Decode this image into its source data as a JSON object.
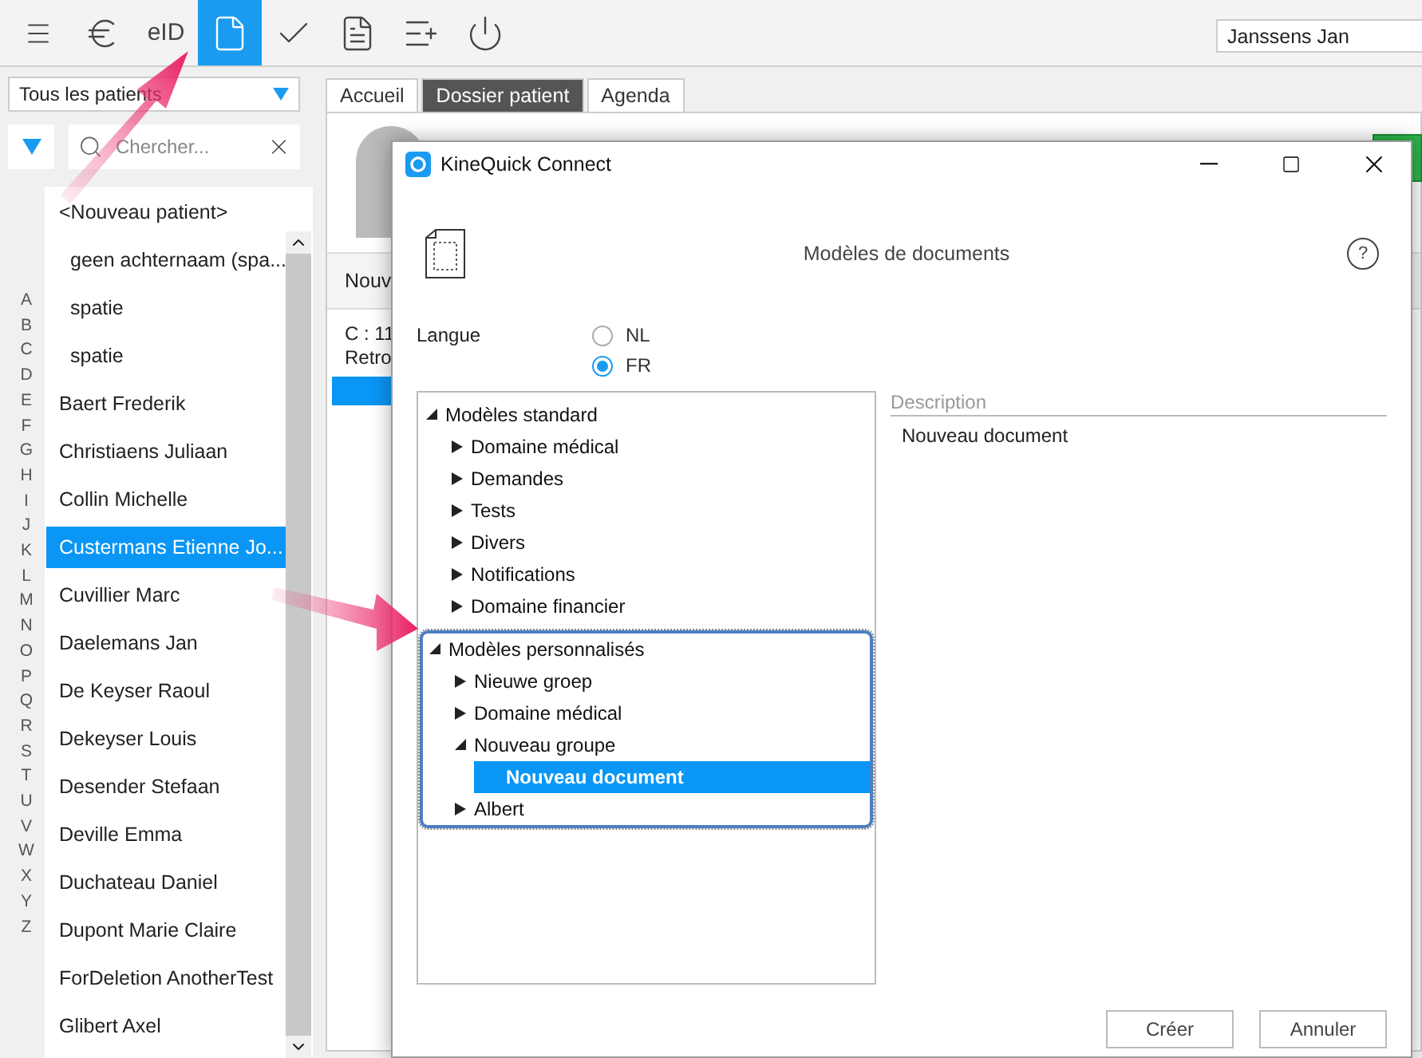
{
  "toolbar": [
    {
      "kind": "menu",
      "selected": false
    },
    {
      "kind": "euro",
      "selected": false
    },
    {
      "kind": "eid",
      "label": "eID",
      "selected": false
    },
    {
      "kind": "document",
      "selected": true
    },
    {
      "kind": "check",
      "selected": false
    },
    {
      "kind": "invoice",
      "selected": false
    },
    {
      "kind": "addlist",
      "selected": false
    },
    {
      "kind": "power",
      "selected": false
    }
  ],
  "user_field": {
    "value": "Janssens Jan"
  },
  "sidebar": {
    "filter": {
      "value": "Tous les patients"
    },
    "search": {
      "placeholder": "Chercher..."
    },
    "letters": [
      "A",
      "B",
      "C",
      "D",
      "E",
      "F",
      "G",
      "H",
      "I",
      "J",
      "K",
      "L",
      "M",
      "N",
      "O",
      "P",
      "Q",
      "R",
      "S",
      "T",
      "U",
      "V",
      "W",
      "X",
      "Y",
      "Z"
    ],
    "patients": [
      {
        "name": "<Nouveau patient>",
        "indented": false,
        "selected": false
      },
      {
        "name": "geen achternaam (spa...",
        "indented": true,
        "selected": false
      },
      {
        "name": "spatie",
        "indented": true,
        "selected": false
      },
      {
        "name": "spatie",
        "indented": true,
        "selected": false
      },
      {
        "name": "Baert Frederik",
        "indented": false,
        "selected": false
      },
      {
        "name": "Christiaens Juliaan",
        "indented": false,
        "selected": false
      },
      {
        "name": "Collin Michelle",
        "indented": false,
        "selected": false
      },
      {
        "name": "Custermans Etienne Jo...",
        "indented": false,
        "selected": true
      },
      {
        "name": "Cuvillier Marc",
        "indented": false,
        "selected": false
      },
      {
        "name": "Daelemans Jan",
        "indented": false,
        "selected": false
      },
      {
        "name": "De Keyser Raoul",
        "indented": false,
        "selected": false
      },
      {
        "name": "Dekeyser Louis",
        "indented": false,
        "selected": false
      },
      {
        "name": "Desender Stefaan",
        "indented": false,
        "selected": false
      },
      {
        "name": "Deville Emma",
        "indented": false,
        "selected": false
      },
      {
        "name": "Duchateau Daniel",
        "indented": false,
        "selected": false
      },
      {
        "name": "Dupont Marie Claire",
        "indented": false,
        "selected": false
      },
      {
        "name": "ForDeletion AnotherTest",
        "indented": false,
        "selected": false
      },
      {
        "name": "Glibert Axel",
        "indented": false,
        "selected": false
      }
    ]
  },
  "main_tabs": [
    {
      "label": "Accueil",
      "selected": false
    },
    {
      "label": "Dossier patient",
      "selected": true
    },
    {
      "label": "Agenda",
      "selected": false
    }
  ],
  "patient_panel": {
    "row_1": "Nouv",
    "line_1": "C : 11",
    "line_2": "Retro"
  },
  "dialog": {
    "title": "KineQuick Connect",
    "heading": "Modèles de documents",
    "language": {
      "label": "Langue",
      "options": [
        {
          "label": "NL",
          "selected": false
        },
        {
          "label": "FR",
          "selected": true
        }
      ]
    },
    "tree": [
      {
        "label": "Modèles standard",
        "expanded": true,
        "focused": false,
        "selected": false,
        "children": [
          {
            "label": "Domaine médical",
            "expanded": false,
            "focused": false,
            "selected": false
          },
          {
            "label": "Demandes",
            "expanded": false,
            "focused": false,
            "selected": false
          },
          {
            "label": "Tests",
            "expanded": false,
            "focused": false,
            "selected": false
          },
          {
            "label": "Divers",
            "expanded": false,
            "focused": false,
            "selected": false
          },
          {
            "label": "Notifications",
            "expanded": false,
            "focused": false,
            "selected": false
          },
          {
            "label": "Domaine financier",
            "expanded": false,
            "focused": false,
            "selected": false
          }
        ]
      },
      {
        "label": "Modèles personnalisés",
        "expanded": true,
        "focused": true,
        "selected": false,
        "children": [
          {
            "label": "Nieuwe groep",
            "expanded": false,
            "focused": false,
            "selected": false
          },
          {
            "label": "Domaine médical",
            "expanded": false,
            "focused": false,
            "selected": false
          },
          {
            "label": "Nouveau groupe",
            "expanded": true,
            "focused": false,
            "selected": false,
            "children": [
              {
                "label": "Nouveau document",
                "expanded": false,
                "focused": false,
                "selected": true,
                "leaf": true
              }
            ]
          },
          {
            "label": "Albert",
            "expanded": false,
            "focused": false,
            "selected": false
          }
        ]
      }
    ],
    "description": {
      "label": "Description",
      "text": "Nouveau document"
    },
    "help": "?",
    "buttons": [
      "Créer",
      "Annuler"
    ]
  }
}
